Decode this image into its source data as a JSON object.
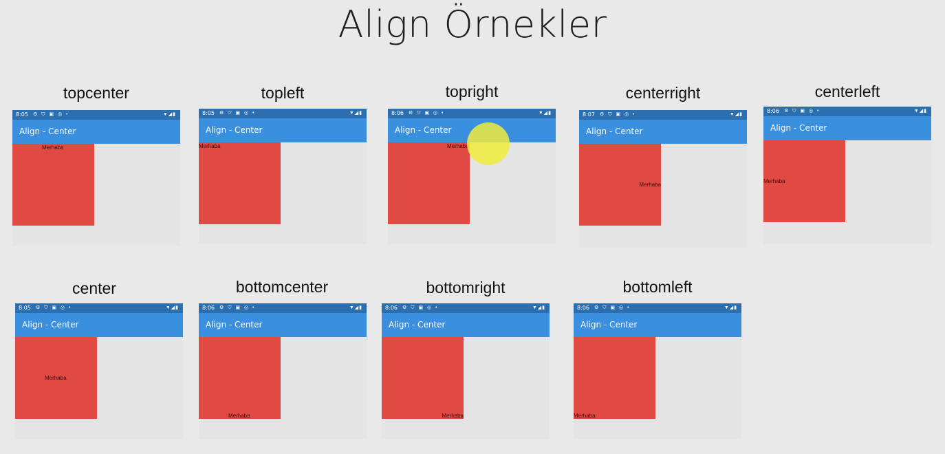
{
  "title": "Align Örnekler",
  "app_bar_title": "Align - Center",
  "box_text": "Merhaba",
  "colors": {
    "status_bar": "#2b6fb1",
    "app_bar": "#3a8fdf",
    "box": "#e04a43",
    "background": "#e9e9e9"
  },
  "examples": [
    {
      "label": "topcenter",
      "time": "8:05"
    },
    {
      "label": "topleft",
      "time": "8:05"
    },
    {
      "label": "topright",
      "time": "8:06"
    },
    {
      "label": "centerright",
      "time": "8:07"
    },
    {
      "label": "centerleft",
      "time": "8:06"
    },
    {
      "label": "center",
      "time": "8:05"
    },
    {
      "label": "bottomcenter",
      "time": "8:06"
    },
    {
      "label": "bottomright",
      "time": "8:06"
    },
    {
      "label": "bottomleft",
      "time": "8:06"
    }
  ],
  "status_icons": "⚙ ⛉ ▣ ◎ •",
  "status_right_icons": "▼◢▮"
}
